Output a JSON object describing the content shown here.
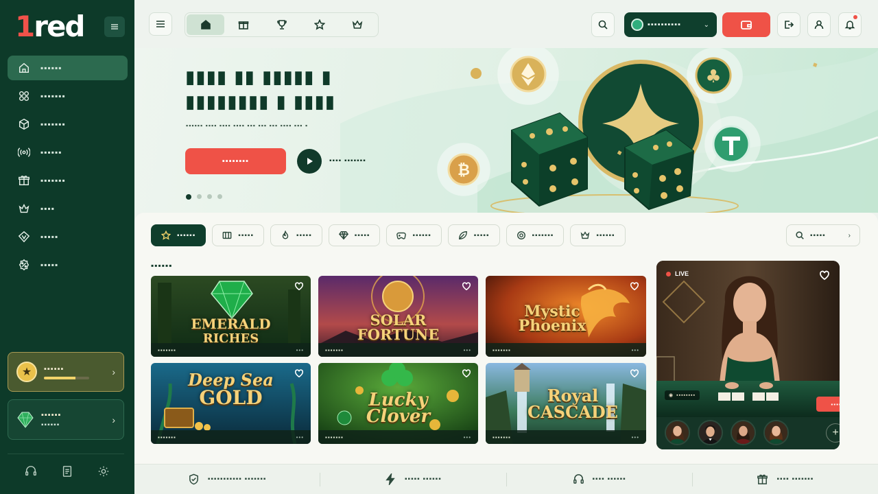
{
  "brand": {
    "logo_prefix": "1",
    "logo_suffix": "red"
  },
  "sidebar": {
    "items": [
      {
        "label": "▪▪▪▪▪▪",
        "icon": "home-icon"
      },
      {
        "label": "▪▪▪▪▪▪▪",
        "icon": "grid-icon"
      },
      {
        "label": "▪▪▪▪▪▪▪",
        "icon": "cube-icon"
      },
      {
        "label": "▪▪▪▪▪▪",
        "icon": "broadcast-icon"
      },
      {
        "label": "▪▪▪▪▪▪▪",
        "icon": "gift-icon"
      },
      {
        "label": "▪▪▪▪",
        "icon": "crown-icon"
      },
      {
        "label": "▪▪▪▪▪",
        "icon": "vip-shield-icon"
      },
      {
        "label": "▪▪▪▪▪",
        "icon": "percent-badge-icon"
      }
    ],
    "vip_card": {
      "title": "▪▪▪▪▪▪",
      "progress": 0.7
    },
    "gem_card": {
      "title": "▪▪▪▪▪▪",
      "subtitle": "▪▪▪▪▪▪"
    }
  },
  "topbar": {
    "wallet_label": "▪▪▪▪▪▪▪▪▪▪",
    "wallet_caret": "⌄"
  },
  "hero": {
    "title_line1": "▮▮▮▮ ▮▮ ▮▮▮▮▮ ▮",
    "title_line2": "▮▮▮▮▮▮▮▮ ▮ ▮▮▮▮",
    "subtitle": "▪▪▪▪▪▪ ▪▪▪▪ ▪▪▪▪ ▪▪▪▪ ▪▪▪ ▪▪▪ ▪▪▪ ▪▪▪▪ ▪▪▪ ▪",
    "cta_label": "▪▪▪▪▪▪▪▪",
    "secondary_label": "▪▪▪▪ ▪▪▪▪▪▪▪",
    "slides": 4,
    "active_slide": 1
  },
  "filters": [
    {
      "label": "▪▪▪▪▪▪",
      "icon": "star-icon",
      "active": true
    },
    {
      "label": "▪▪▪▪▪",
      "icon": "slot-machine-icon"
    },
    {
      "label": "▪▪▪▪▪",
      "icon": "flame-icon"
    },
    {
      "label": "▪▪▪▪▪",
      "icon": "diamond-icon"
    },
    {
      "label": "▪▪▪▪▪▪",
      "icon": "gamepad-icon"
    },
    {
      "label": "▪▪▪▪▪",
      "icon": "leaf-icon"
    },
    {
      "label": "▪▪▪▪▪▪▪",
      "icon": "target-icon"
    },
    {
      "label": "▪▪▪▪▪▪",
      "icon": "crown-icon"
    }
  ],
  "search_label": "▪▪▪▪▪",
  "section_title": "▪▪▪▪▪▪",
  "games": [
    {
      "name_line1": "EMERALD",
      "name_line2": "RICHES",
      "meta": "▪▪▪▪▪▪▪",
      "theme": "#1f5a2d"
    },
    {
      "name_line1": "SOLAR",
      "name_line2": "FORTUNE",
      "meta": "▪▪▪▪▪▪▪",
      "theme": "#8a3a52"
    },
    {
      "name_line1": "Mystic",
      "name_line2": "Phoenix",
      "meta": "▪▪▪▪▪▪▪",
      "theme": "#a8401c"
    },
    {
      "name_line1": "Deep Sea",
      "name_line2": "GOLD",
      "meta": "▪▪▪▪▪▪▪",
      "theme": "#0f4a6a"
    },
    {
      "name_line1": "Lucky",
      "name_line2": "Clover",
      "meta": "▪▪▪▪▪▪▪",
      "theme": "#2a6a24"
    },
    {
      "name_line1": "Royal",
      "name_line2": "CASCADE",
      "meta": "▪▪▪▪▪▪▪",
      "theme": "#3a6a8a"
    }
  ],
  "live": {
    "badge": "LIVE",
    "tag": "▪▪▪▪▪▪▪▪",
    "cta": "▪▪▪▪▪",
    "add": "+"
  },
  "footer": [
    {
      "label": "▪▪▪▪▪▪▪▪▪▪▪ ▪▪▪▪▪▪▪",
      "icon": "shield-check-icon"
    },
    {
      "label": "▪▪▪▪▪ ▪▪▪▪▪▪",
      "icon": "lightning-icon"
    },
    {
      "label": "▪▪▪▪ ▪▪▪▪▪▪",
      "icon": "headset-icon"
    },
    {
      "label": "▪▪▪▪ ▪▪▪▪▪▪▪",
      "icon": "gift-icon"
    }
  ]
}
